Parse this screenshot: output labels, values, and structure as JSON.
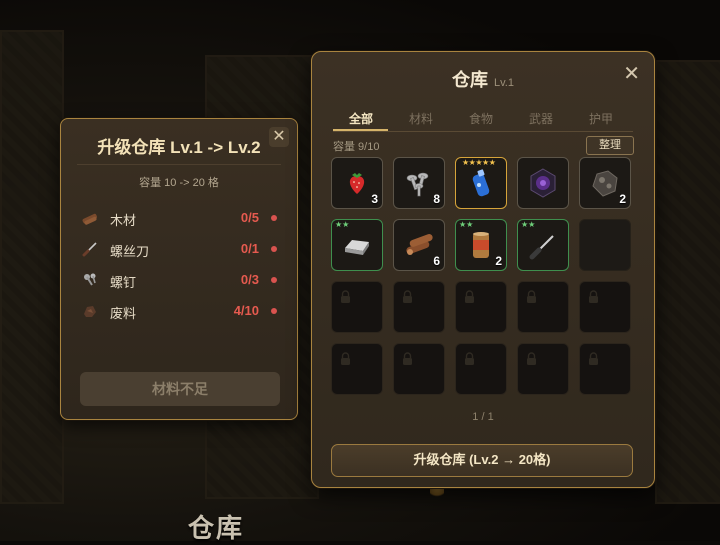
{
  "background": {
    "label": "仓库"
  },
  "upgrade_panel": {
    "title": "升级仓库 Lv.1 -> Lv.2",
    "close": "✕",
    "capacity_text": "容量 10 -> 20 格",
    "materials": [
      {
        "name": "木材",
        "value": "0/5",
        "icon": "wood-icon"
      },
      {
        "name": "螺丝刀",
        "value": "0/1",
        "icon": "screwdriver-icon"
      },
      {
        "name": "螺钉",
        "value": "0/3",
        "icon": "screw-icon"
      },
      {
        "name": "废料",
        "value": "4/10",
        "icon": "scrap-icon"
      }
    ],
    "button": "材料不足"
  },
  "warehouse": {
    "title": "仓库",
    "level": "Lv.1",
    "close": "✕",
    "tabs": [
      "全部",
      "材料",
      "食物",
      "武器",
      "护甲"
    ],
    "active_tab": "全部",
    "capacity": "容量 9/10",
    "sort_button": "整理",
    "slots": [
      {
        "item": "strawberry",
        "count": "3",
        "stars": ""
      },
      {
        "item": "screws",
        "count": "8",
        "stars": ""
      },
      {
        "item": "potion",
        "count": "",
        "stars": "★★★★★"
      },
      {
        "item": "rune",
        "count": "",
        "stars": ""
      },
      {
        "item": "scrap",
        "count": "2",
        "stars": ""
      },
      {
        "item": "iron-ingot",
        "count": "",
        "stars": "★★"
      },
      {
        "item": "logs",
        "count": "6",
        "stars": ""
      },
      {
        "item": "can",
        "count": "2",
        "stars": "★★"
      },
      {
        "item": "screwdriver",
        "count": "",
        "stars": "★★"
      }
    ],
    "pager": "1 / 1",
    "upgrade_button": "升级仓库 (Lv.2 → 20格)"
  },
  "colors": {
    "accent": "#a9843f",
    "danger": "#e55a4f",
    "rare_green": "#3f8f4e",
    "rare_gold": "#d6a43a"
  }
}
